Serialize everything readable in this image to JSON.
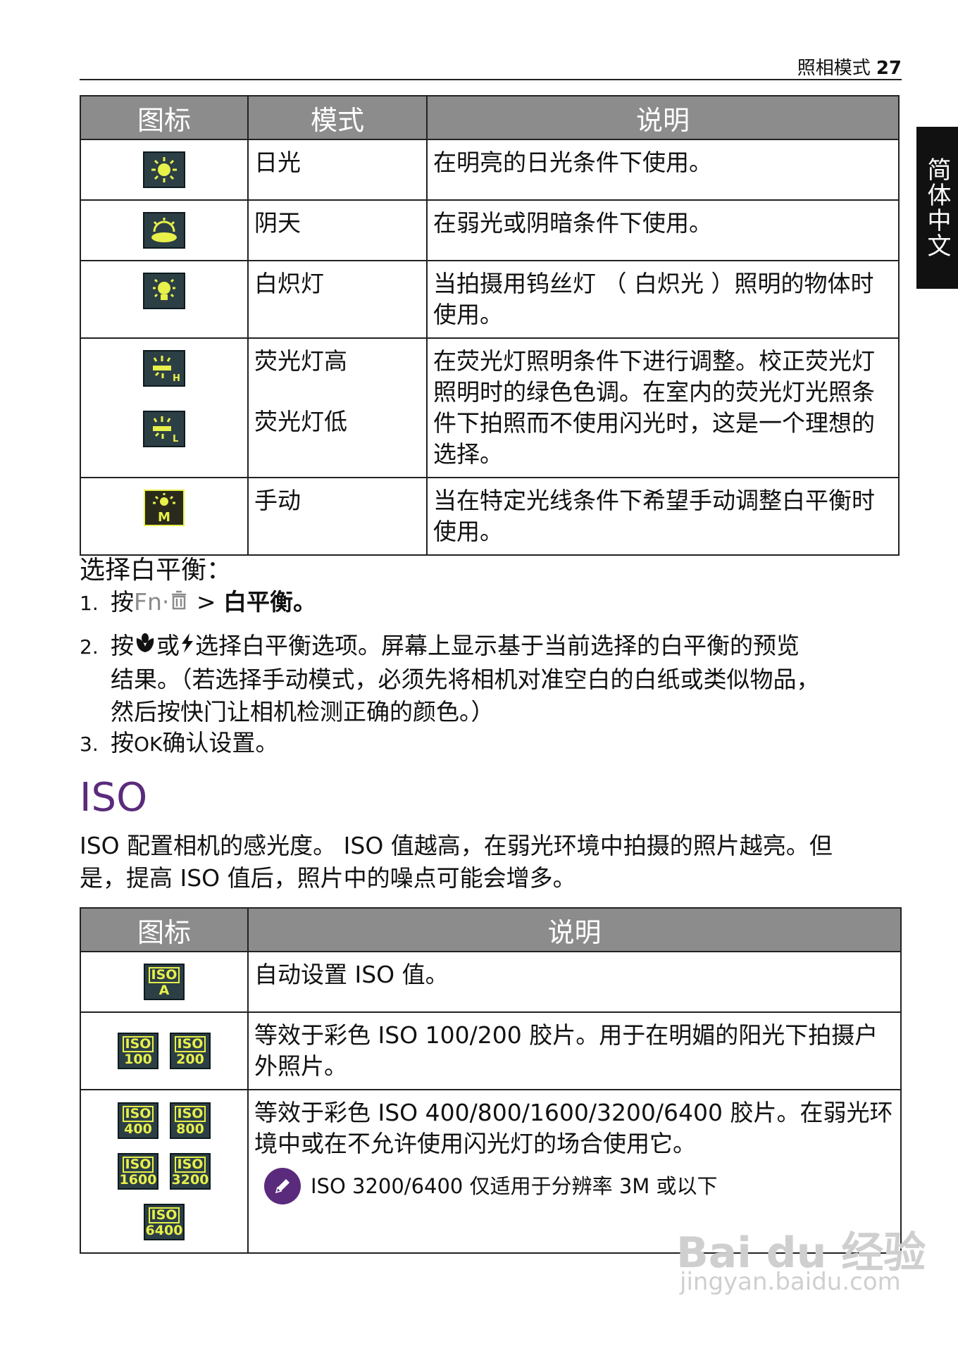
{
  "header": {
    "section": "照相模式",
    "page_number": "27"
  },
  "side_tab": "简体中文",
  "wb_table": {
    "headers": [
      "图标",
      "模式",
      "说明"
    ],
    "rows": [
      {
        "icon": "sun-icon",
        "mode": "日光",
        "desc": "在明亮的日光条件下使用。"
      },
      {
        "icon": "cloudy-icon",
        "mode": "阴天",
        "desc": "在弱光或阴暗条件下使用。"
      },
      {
        "icon": "bulb-icon",
        "mode": "白炽灯",
        "desc": "当拍摄用钨丝灯 （ 白炽光 ）照明的物体时使用。"
      },
      {
        "icon": "fluorescent-icon",
        "mode": "荧光灯高",
        "mode2": "荧光灯低",
        "desc": "在荧光灯照明条件下进行调整。校正荧光灯照明时的绿色色调。在室内的荧光灯光照条件下拍照而不使用闪光时，这是一个理想的选择。"
      },
      {
        "icon": "manual-icon",
        "mode": "手动",
        "desc": "当在特定光线条件下希望手动调整白平衡时使用。"
      }
    ],
    "icon_letters": {
      "high": "H",
      "low": "L",
      "manual": "M"
    }
  },
  "wb_steps": {
    "intro": "选择白平衡：",
    "s1_num": "1.",
    "s1_pre": "按",
    "s1_key": "Fn·",
    "s1_mid": " > ",
    "s1_bold": "白平衡。",
    "s2_num": "2.",
    "s2_pre": "按",
    "s2_mid": "或",
    "s2_rest": "选择白平衡选项。屏幕上显示基于当前选择的白平衡的预览",
    "s2_line2": "结果。（若选择手动模式，必须先将相机对准空白的白纸或类似物品，",
    "s2_line3": "然后按快门让相机检测正确的颜色。）",
    "s3_num": "3.",
    "s3_pre": "按",
    "s3_key": "OK",
    "s3_rest": "确认设置。"
  },
  "iso_section": {
    "heading": "ISO",
    "desc_line1": "ISO 配置相机的感光度。 ISO 值越高，在弱光环境中拍摄的照片越亮。但",
    "desc_line2": "是，提高 ISO 值后，照片中的噪点可能会增多。"
  },
  "iso_table": {
    "headers": [
      "图标",
      "说明"
    ],
    "iso_label": "ISO",
    "rows": [
      {
        "values": [
          "A"
        ],
        "desc": "自动设置 ISO 值。"
      },
      {
        "values": [
          "100",
          "200"
        ],
        "desc": "等效于彩色 ISO 100/200 胶片。用于在明媚的阳光下拍摄户外照片。"
      },
      {
        "values": [
          "400",
          "800",
          "1600",
          "3200",
          "6400"
        ],
        "desc": "等效于彩色 ISO 400/800/1600/3200/6400 胶片。在弱光环境中或在不允许使用闪光灯的场合使用它。",
        "note": "ISO 3200/6400 仅适用于分辨率 3M 或以下"
      }
    ]
  },
  "watermark": {
    "line1": "Bai du 经验",
    "line2": "jingyan.baidu.com"
  },
  "colors": {
    "header_bg": "#8c8c8c",
    "icon_bg": "#2c3f45",
    "icon_fg": "#e8f04a",
    "accent": "#5a2b7c"
  }
}
